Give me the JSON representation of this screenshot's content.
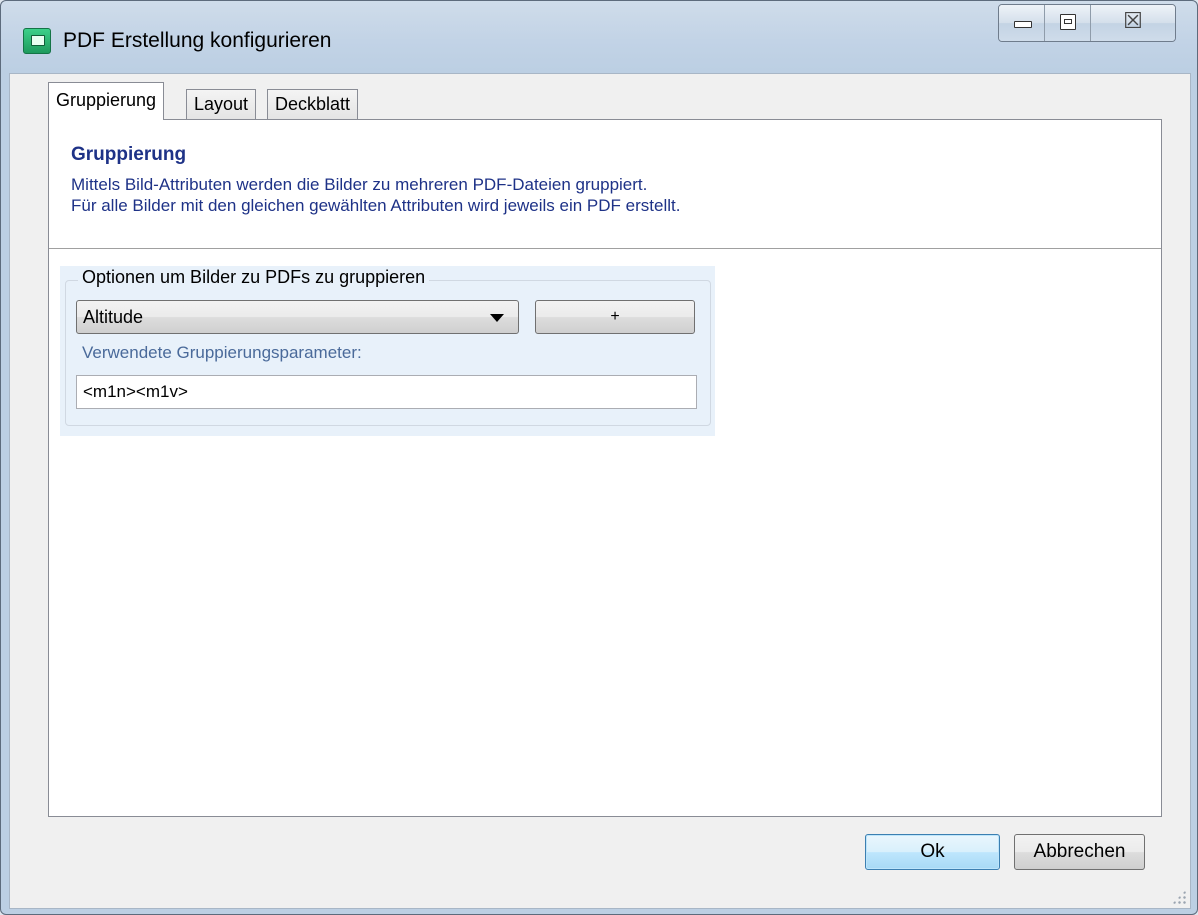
{
  "window": {
    "title": "PDF Erstellung konfigurieren",
    "close_glyph": "☒"
  },
  "tabs": [
    {
      "label": "Gruppierung",
      "active": true
    },
    {
      "label": "Layout",
      "active": false
    },
    {
      "label": "Deckblatt",
      "active": false
    }
  ],
  "panel": {
    "heading": "Gruppierung",
    "description_line1": "Mittels Bild-Attributen werden die Bilder zu mehreren PDF-Dateien gruppiert.",
    "description_line2": "Für alle Bilder mit den gleichen gewählten Attributen wird jeweils ein PDF erstellt."
  },
  "options": {
    "legend": "Optionen um Bilder zu PDFs zu gruppieren",
    "combo_value": "Altitude",
    "add_label": "+",
    "params_label": "Verwendete Gruppierungsparameter:",
    "params_value": "<m1n><m1v>"
  },
  "footer": {
    "ok_label": "Ok",
    "cancel_label": "Abbrechen"
  },
  "colors": {
    "heading_blue": "#1e3287",
    "options_bg": "#e8f1fa",
    "chrome": "#bccfe3"
  }
}
